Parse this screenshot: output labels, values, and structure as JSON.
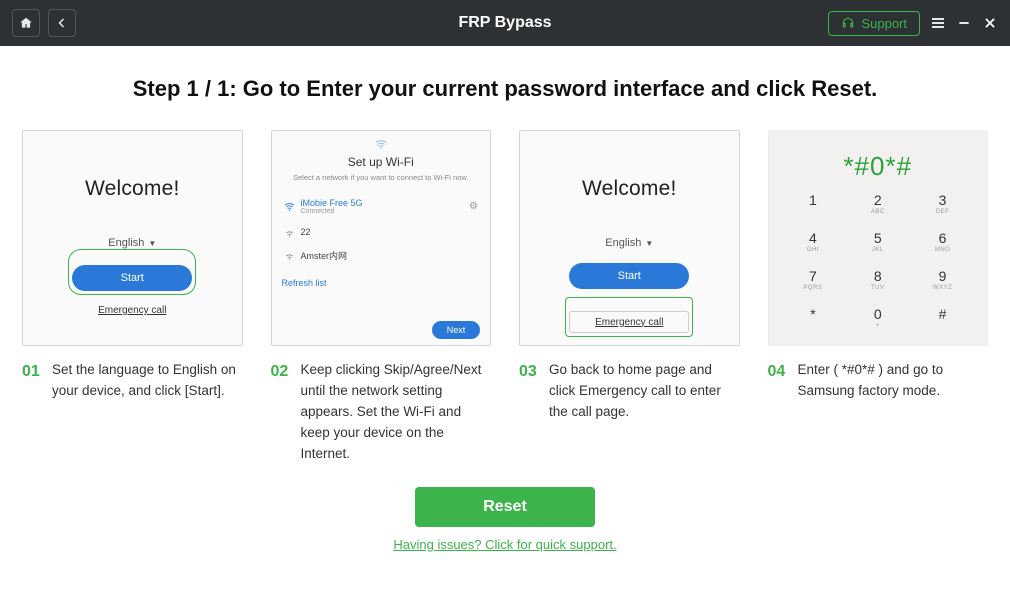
{
  "titlebar": {
    "title": "FRP Bypass",
    "support_label": "Support"
  },
  "heading": "Step 1 / 1: Go to Enter your current password interface and click Reset.",
  "steps": [
    {
      "num": "01",
      "caption": "Set the language to English on your device, and click [Start].",
      "thumb": {
        "welcome": "Welcome!",
        "language": "English",
        "start": "Start",
        "emergency": "Emergency call"
      }
    },
    {
      "num": "02",
      "caption": "Keep clicking Skip/Agree/Next until the network setting appears. Set the Wi-Fi and keep your device on the Internet.",
      "thumb": {
        "title": "Set up Wi-Fi",
        "subtitle": "Select a network if you want to connect to Wi-Fi now.",
        "net1_name": "iMobie Free 5G",
        "net1_status": "Connected",
        "net2_name": "22",
        "net3_name": "Amster内网",
        "refresh": "Refresh list",
        "next": "Next"
      }
    },
    {
      "num": "03",
      "caption": "Go back to home page and click Emergency call to enter the call page.",
      "thumb": {
        "welcome": "Welcome!",
        "language": "English",
        "start": "Start",
        "emergency": "Emergency call"
      }
    },
    {
      "num": "04",
      "caption": "Enter ( *#0*# ) and go to Samsung factory mode.",
      "thumb": {
        "display": "*#0*#",
        "keys": [
          {
            "n": "1",
            "l": ""
          },
          {
            "n": "2",
            "l": "ABC"
          },
          {
            "n": "3",
            "l": "DEF"
          },
          {
            "n": "4",
            "l": "GHI"
          },
          {
            "n": "5",
            "l": "JKL"
          },
          {
            "n": "6",
            "l": "MNO"
          },
          {
            "n": "7",
            "l": "PQRS"
          },
          {
            "n": "8",
            "l": "TUV"
          },
          {
            "n": "9",
            "l": "WXYZ"
          },
          {
            "n": "*",
            "l": ""
          },
          {
            "n": "0",
            "l": "+"
          },
          {
            "n": "#",
            "l": ""
          }
        ]
      }
    }
  ],
  "bottom": {
    "reset_label": "Reset",
    "issues_label": "Having issues? Click for quick support."
  }
}
